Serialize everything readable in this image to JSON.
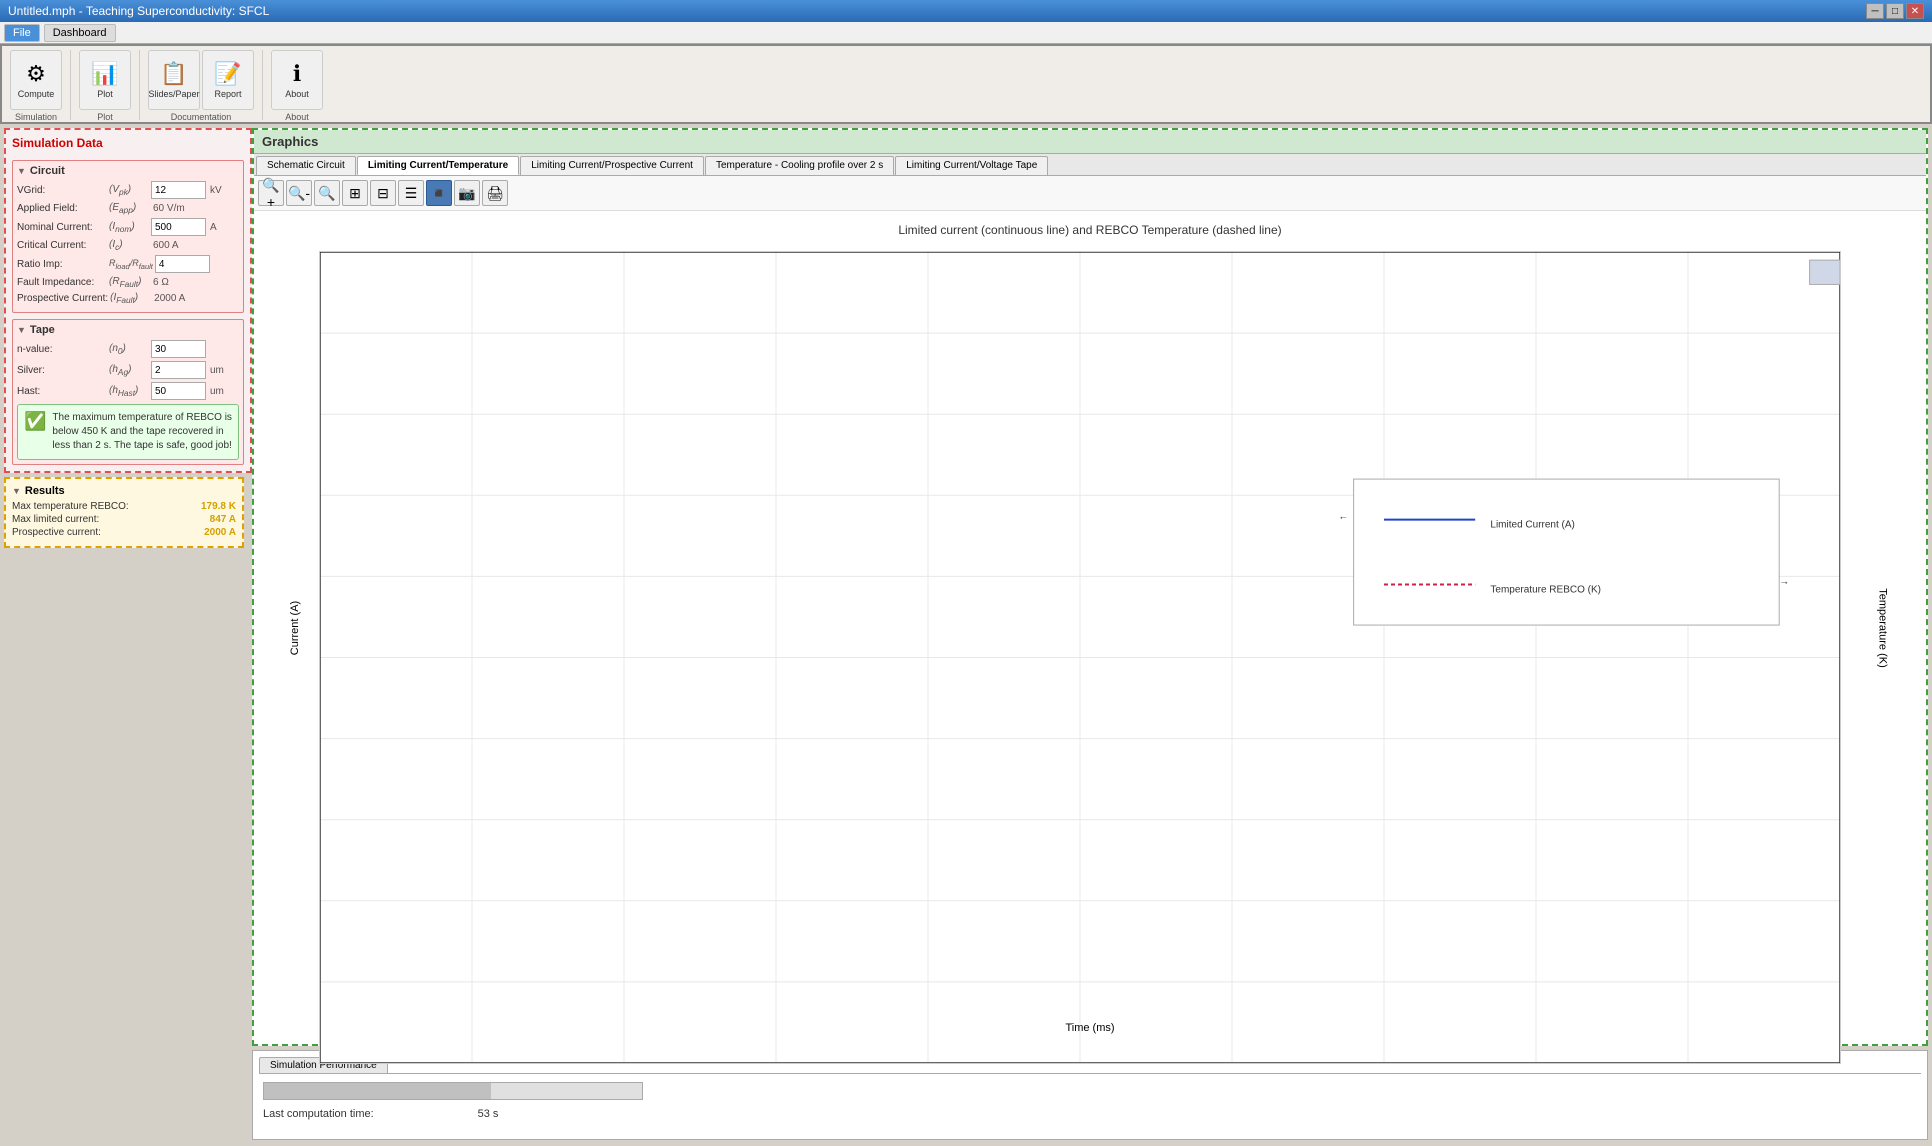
{
  "titleBar": {
    "title": "Untitled.mph - Teaching Superconductivity: SFCL",
    "minBtn": "─",
    "maxBtn": "□",
    "closeBtn": "✕"
  },
  "menuBar": {
    "items": [
      {
        "label": "File",
        "active": true
      },
      {
        "label": "Dashboard",
        "active": false
      }
    ]
  },
  "toolbar": {
    "buttons": [
      {
        "icon": "⚙",
        "label": "Compute",
        "section": "Simulation"
      },
      {
        "icon": "📊",
        "label": "Plot",
        "section": "Plot"
      },
      {
        "icon": "📋",
        "label": "Slides/Paper",
        "section": "Documentation"
      },
      {
        "icon": "📝",
        "label": "Report",
        "section": "Documentation"
      },
      {
        "icon": "ℹ",
        "label": "About",
        "section": "About"
      }
    ]
  },
  "sidebar": {
    "title": "Simulation Data",
    "circuit": {
      "header": "Circuit",
      "fields": [
        {
          "label": "VGrid:",
          "symbol": "(Vpk)",
          "value": "12",
          "unit": "kV"
        },
        {
          "label": "Applied Field:",
          "symbol": "(Eapp)",
          "value": "60 V/m",
          "unit": ""
        },
        {
          "label": "Nominal Current:",
          "symbol": "(Inom)",
          "value": "500",
          "unit": "A"
        },
        {
          "label": "Critical Current:",
          "symbol": "(Ic)",
          "value": "600 A",
          "unit": ""
        },
        {
          "label": "Ratio Imp:",
          "symbol": "Rload/Rfault",
          "value": "4",
          "unit": ""
        },
        {
          "label": "Fault Impedance:",
          "symbol": "(RFault)",
          "value": "6 Ω",
          "unit": ""
        },
        {
          "label": "Prospective Current:",
          "symbol": "(IFault)",
          "value": "2000 A",
          "unit": ""
        }
      ]
    },
    "tape": {
      "header": "Tape",
      "fields": [
        {
          "label": "n-value:",
          "symbol": "(n0)",
          "value": "30",
          "unit": ""
        },
        {
          "label": "Silver:",
          "symbol": "(hAg)",
          "value": "2",
          "unit": "um"
        },
        {
          "label": "Hast:",
          "symbol": "(hHast)",
          "value": "50",
          "unit": "um"
        }
      ]
    },
    "successMessage": "The maximum temperature of REBCO is below 450 K and the tape recovered in less than 2 s. The tape is safe, good job!"
  },
  "results": {
    "header": "Results",
    "items": [
      {
        "label": "Max temperature REBCO:",
        "value": "179.8 K"
      },
      {
        "label": "Max limited current:",
        "value": "847 A"
      },
      {
        "label": "Prospective current:",
        "value": "2000 A"
      }
    ]
  },
  "graphics": {
    "header": "Graphics",
    "tabs": [
      {
        "label": "Schematic Circuit",
        "active": false
      },
      {
        "label": "Limiting Current/Temperature",
        "active": true
      },
      {
        "label": "Limiting Current/Prospective Current",
        "active": false
      },
      {
        "label": "Temperature - Cooling profile over 2 s",
        "active": false
      },
      {
        "label": "Limiting Current/Voltage Tape",
        "active": false
      }
    ],
    "toolbar": {
      "tools": [
        {
          "icon": "🔍+",
          "label": "zoom-in"
        },
        {
          "icon": "🔍-",
          "label": "zoom-out"
        },
        {
          "icon": "🔍",
          "label": "zoom-custom"
        },
        {
          "icon": "⊞",
          "label": "fit"
        },
        {
          "icon": "⊟",
          "label": "fit-v"
        },
        {
          "icon": "☰",
          "label": "legend"
        },
        {
          "icon": "▪",
          "label": "mode-active"
        },
        {
          "icon": "📷",
          "label": "camera"
        },
        {
          "icon": "🖨",
          "label": "print"
        }
      ]
    },
    "chart": {
      "title": "Limited current (continuous line) and REBCO Temperature (dashed line)",
      "xAxis": "Time (ms)",
      "yAxisLeft": "Current (A)",
      "yAxisRight": "Temperature (K)",
      "legend": {
        "items": [
          {
            "label": "Limited Current (A)",
            "type": "solid-blue"
          },
          {
            "label": "Temperature REBCO (K)",
            "type": "dashed-red"
          }
        ]
      }
    }
  },
  "simPerformance": {
    "tab": "Simulation Performance",
    "progressValue": 60,
    "compTimeLabel": "Last computation time:",
    "compTimeValue": "53 s"
  }
}
